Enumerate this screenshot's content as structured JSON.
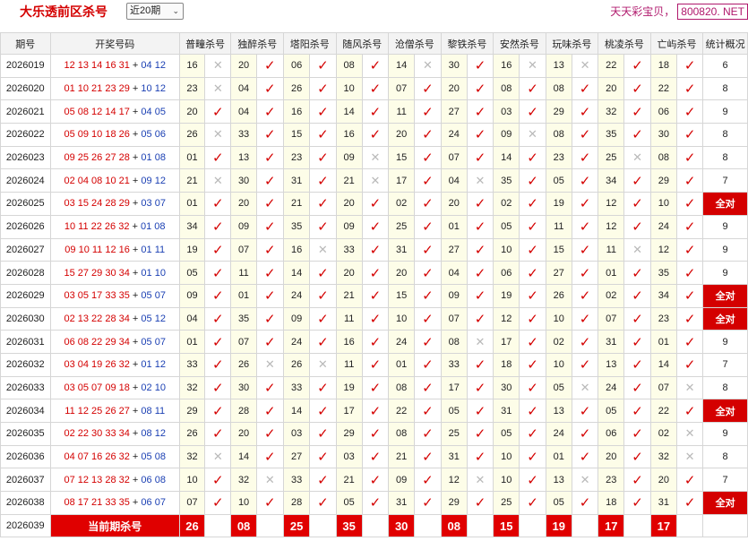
{
  "header": {
    "title": "大乐透前区杀号",
    "period_select": "近20期",
    "brand_text": "天天彩宝贝，",
    "brand_url": "800820. NET"
  },
  "columns": [
    "期号",
    "开奖号码",
    "普疃杀号",
    "独醉杀号",
    "塔阳杀号",
    "随风杀号",
    "沧僧杀号",
    "黎铁杀号",
    "安然杀号",
    "玩味杀号",
    "桃凌杀号",
    "亡屿杀号",
    "统计概况"
  ],
  "rows": [
    {
      "period": "2026019",
      "front": "12 13 14 16 31",
      "back": "04 12",
      "cells": [
        [
          "16",
          "x"
        ],
        [
          "20",
          "v"
        ],
        [
          "06",
          "v"
        ],
        [
          "08",
          "v"
        ],
        [
          "14",
          "x"
        ],
        [
          "30",
          "v"
        ],
        [
          "16",
          "x"
        ],
        [
          "13",
          "x"
        ],
        [
          "22",
          "v"
        ],
        [
          "18",
          "v"
        ]
      ],
      "stat": "6"
    },
    {
      "period": "2026020",
      "front": "01 10 21 23 29",
      "back": "10 12",
      "cells": [
        [
          "23",
          "x"
        ],
        [
          "04",
          "v"
        ],
        [
          "26",
          "v"
        ],
        [
          "10",
          "v"
        ],
        [
          "07",
          "v"
        ],
        [
          "20",
          "v"
        ],
        [
          "08",
          "v"
        ],
        [
          "08",
          "v"
        ],
        [
          "20",
          "v"
        ],
        [
          "22",
          "v"
        ]
      ],
      "stat": "8"
    },
    {
      "period": "2026021",
      "front": "05 08 12 14 17",
      "back": "04 05",
      "cells": [
        [
          "20",
          "v"
        ],
        [
          "04",
          "v"
        ],
        [
          "16",
          "v"
        ],
        [
          "14",
          "v"
        ],
        [
          "11",
          "v"
        ],
        [
          "27",
          "v"
        ],
        [
          "03",
          "v"
        ],
        [
          "29",
          "v"
        ],
        [
          "32",
          "v"
        ],
        [
          "06",
          "v"
        ]
      ],
      "stat": "9"
    },
    {
      "period": "2026022",
      "front": "05 09 10 18 26",
      "back": "05 06",
      "cells": [
        [
          "26",
          "x"
        ],
        [
          "33",
          "v"
        ],
        [
          "15",
          "v"
        ],
        [
          "16",
          "v"
        ],
        [
          "20",
          "v"
        ],
        [
          "24",
          "v"
        ],
        [
          "09",
          "x"
        ],
        [
          "08",
          "v"
        ],
        [
          "35",
          "v"
        ],
        [
          "30",
          "v"
        ]
      ],
      "stat": "8"
    },
    {
      "period": "2026023",
      "front": "09 25 26 27 28",
      "back": "01 08",
      "cells": [
        [
          "01",
          "v"
        ],
        [
          "13",
          "v"
        ],
        [
          "23",
          "v"
        ],
        [
          "09",
          "x"
        ],
        [
          "15",
          "v"
        ],
        [
          "07",
          "v"
        ],
        [
          "14",
          "v"
        ],
        [
          "23",
          "v"
        ],
        [
          "25",
          "x"
        ],
        [
          "08",
          "v"
        ]
      ],
      "stat": "8"
    },
    {
      "period": "2026024",
      "front": "02 04 08 10 21",
      "back": "09 12",
      "cells": [
        [
          "21",
          "x"
        ],
        [
          "30",
          "v"
        ],
        [
          "31",
          "v"
        ],
        [
          "21",
          "x"
        ],
        [
          "17",
          "v"
        ],
        [
          "04",
          "x"
        ],
        [
          "35",
          "v"
        ],
        [
          "05",
          "v"
        ],
        [
          "34",
          "v"
        ],
        [
          "29",
          "v"
        ]
      ],
      "stat": "7"
    },
    {
      "period": "2026025",
      "front": "03 15 24 28 29",
      "back": "03 07",
      "cells": [
        [
          "01",
          "v"
        ],
        [
          "20",
          "v"
        ],
        [
          "21",
          "v"
        ],
        [
          "20",
          "v"
        ],
        [
          "02",
          "v"
        ],
        [
          "20",
          "v"
        ],
        [
          "02",
          "v"
        ],
        [
          "19",
          "v"
        ],
        [
          "12",
          "v"
        ],
        [
          "10",
          "v"
        ]
      ],
      "stat": "全对"
    },
    {
      "period": "2026026",
      "front": "10 11 22 26 32",
      "back": "01 08",
      "cells": [
        [
          "34",
          "v"
        ],
        [
          "09",
          "v"
        ],
        [
          "35",
          "v"
        ],
        [
          "09",
          "v"
        ],
        [
          "25",
          "v"
        ],
        [
          "01",
          "v"
        ],
        [
          "05",
          "v"
        ],
        [
          "11",
          "v"
        ],
        [
          "12",
          "v"
        ],
        [
          "24",
          "v"
        ]
      ],
      "stat": "9"
    },
    {
      "period": "2026027",
      "front": "09 10 11 12 16",
      "back": "01 11",
      "cells": [
        [
          "19",
          "v"
        ],
        [
          "07",
          "v"
        ],
        [
          "16",
          "x"
        ],
        [
          "33",
          "v"
        ],
        [
          "31",
          "v"
        ],
        [
          "27",
          "v"
        ],
        [
          "10",
          "v"
        ],
        [
          "15",
          "v"
        ],
        [
          "11",
          "x"
        ],
        [
          "12",
          "v"
        ]
      ],
      "stat": "9"
    },
    {
      "period": "2026028",
      "front": "15 27 29 30 34",
      "back": "01 10",
      "cells": [
        [
          "05",
          "v"
        ],
        [
          "11",
          "v"
        ],
        [
          "14",
          "v"
        ],
        [
          "20",
          "v"
        ],
        [
          "20",
          "v"
        ],
        [
          "04",
          "v"
        ],
        [
          "06",
          "v"
        ],
        [
          "27",
          "v"
        ],
        [
          "01",
          "v"
        ],
        [
          "35",
          "v"
        ]
      ],
      "stat": "9"
    },
    {
      "period": "2026029",
      "front": "03 05 17 33 35",
      "back": "05 07",
      "cells": [
        [
          "09",
          "v"
        ],
        [
          "01",
          "v"
        ],
        [
          "24",
          "v"
        ],
        [
          "21",
          "v"
        ],
        [
          "15",
          "v"
        ],
        [
          "09",
          "v"
        ],
        [
          "19",
          "v"
        ],
        [
          "26",
          "v"
        ],
        [
          "02",
          "v"
        ],
        [
          "34",
          "v"
        ]
      ],
      "stat": "全对"
    },
    {
      "period": "2026030",
      "front": "02 13 22 28 34",
      "back": "05 12",
      "cells": [
        [
          "04",
          "v"
        ],
        [
          "35",
          "v"
        ],
        [
          "09",
          "v"
        ],
        [
          "11",
          "v"
        ],
        [
          "10",
          "v"
        ],
        [
          "07",
          "v"
        ],
        [
          "12",
          "v"
        ],
        [
          "10",
          "v"
        ],
        [
          "07",
          "v"
        ],
        [
          "23",
          "v"
        ]
      ],
      "stat": "全对"
    },
    {
      "period": "2026031",
      "front": "06 08 22 29 34",
      "back": "05 07",
      "cells": [
        [
          "01",
          "v"
        ],
        [
          "07",
          "v"
        ],
        [
          "24",
          "v"
        ],
        [
          "16",
          "v"
        ],
        [
          "24",
          "v"
        ],
        [
          "08",
          "x"
        ],
        [
          "17",
          "v"
        ],
        [
          "02",
          "v"
        ],
        [
          "31",
          "v"
        ],
        [
          "01",
          "v"
        ]
      ],
      "stat": "9"
    },
    {
      "period": "2026032",
      "front": "03 04 19 26 32",
      "back": "01 12",
      "cells": [
        [
          "33",
          "v"
        ],
        [
          "26",
          "x"
        ],
        [
          "26",
          "x"
        ],
        [
          "11",
          "v"
        ],
        [
          "01",
          "v"
        ],
        [
          "33",
          "v"
        ],
        [
          "18",
          "v"
        ],
        [
          "10",
          "v"
        ],
        [
          "13",
          "v"
        ],
        [
          "14",
          "v"
        ]
      ],
      "stat": "7"
    },
    {
      "period": "2026033",
      "front": "03 05 07 09 18",
      "back": "02 10",
      "cells": [
        [
          "32",
          "v"
        ],
        [
          "30",
          "v"
        ],
        [
          "33",
          "v"
        ],
        [
          "19",
          "v"
        ],
        [
          "08",
          "v"
        ],
        [
          "17",
          "v"
        ],
        [
          "30",
          "v"
        ],
        [
          "05",
          "x"
        ],
        [
          "24",
          "v"
        ],
        [
          "07",
          "x"
        ]
      ],
      "stat": "8"
    },
    {
      "period": "2026034",
      "front": "11 12 25 26 27",
      "back": "08 11",
      "cells": [
        [
          "29",
          "v"
        ],
        [
          "28",
          "v"
        ],
        [
          "14",
          "v"
        ],
        [
          "17",
          "v"
        ],
        [
          "22",
          "v"
        ],
        [
          "05",
          "v"
        ],
        [
          "31",
          "v"
        ],
        [
          "13",
          "v"
        ],
        [
          "05",
          "v"
        ],
        [
          "22",
          "v"
        ]
      ],
      "stat": "全对"
    },
    {
      "period": "2026035",
      "front": "02 22 30 33 34",
      "back": "08 12",
      "cells": [
        [
          "26",
          "v"
        ],
        [
          "20",
          "v"
        ],
        [
          "03",
          "v"
        ],
        [
          "29",
          "v"
        ],
        [
          "08",
          "v"
        ],
        [
          "25",
          "v"
        ],
        [
          "05",
          "v"
        ],
        [
          "24",
          "v"
        ],
        [
          "06",
          "v"
        ],
        [
          "02",
          "x"
        ]
      ],
      "stat": "9"
    },
    {
      "period": "2026036",
      "front": "04 07 16 26 32",
      "back": "05 08",
      "cells": [
        [
          "32",
          "x"
        ],
        [
          "14",
          "v"
        ],
        [
          "27",
          "v"
        ],
        [
          "03",
          "v"
        ],
        [
          "21",
          "v"
        ],
        [
          "31",
          "v"
        ],
        [
          "10",
          "v"
        ],
        [
          "01",
          "v"
        ],
        [
          "20",
          "v"
        ],
        [
          "32",
          "x"
        ]
      ],
      "stat": "8"
    },
    {
      "period": "2026037",
      "front": "07 12 13 28 32",
      "back": "06 08",
      "cells": [
        [
          "10",
          "v"
        ],
        [
          "32",
          "x"
        ],
        [
          "33",
          "v"
        ],
        [
          "21",
          "v"
        ],
        [
          "09",
          "v"
        ],
        [
          "12",
          "x"
        ],
        [
          "10",
          "v"
        ],
        [
          "13",
          "x"
        ],
        [
          "23",
          "v"
        ],
        [
          "20",
          "v"
        ]
      ],
      "stat": "7"
    },
    {
      "period": "2026038",
      "front": "08 17 21 33 35",
      "back": "06 07",
      "cells": [
        [
          "07",
          "v"
        ],
        [
          "10",
          "v"
        ],
        [
          "28",
          "v"
        ],
        [
          "05",
          "v"
        ],
        [
          "31",
          "v"
        ],
        [
          "29",
          "v"
        ],
        [
          "25",
          "v"
        ],
        [
          "05",
          "v"
        ],
        [
          "18",
          "v"
        ],
        [
          "31",
          "v"
        ]
      ],
      "stat": "全对"
    }
  ],
  "current": {
    "period": "2026039",
    "label": "当前期杀号",
    "kills": [
      "26",
      "08",
      "25",
      "35",
      "30",
      "08",
      "15",
      "19",
      "17",
      "17"
    ]
  }
}
